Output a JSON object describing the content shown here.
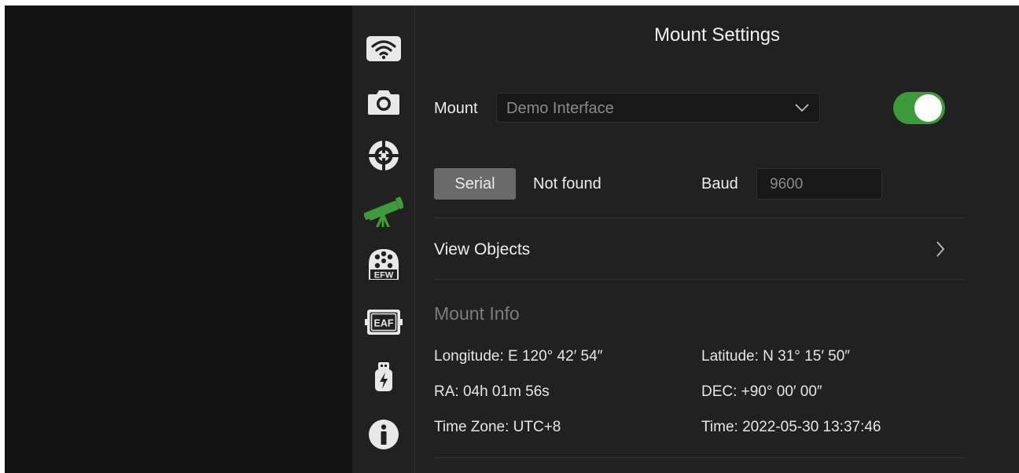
{
  "header": {
    "title": "Mount Settings"
  },
  "sidebar": {
    "items": [
      {
        "name": "wifi",
        "icon": "wifi-icon"
      },
      {
        "name": "camera",
        "icon": "camera-icon"
      },
      {
        "name": "guide",
        "icon": "crosshair-icon"
      },
      {
        "name": "mount",
        "icon": "telescope-icon",
        "active": true
      },
      {
        "name": "efw",
        "icon": "filter-wheel-icon",
        "label": "EFW"
      },
      {
        "name": "eaf",
        "icon": "focuser-icon",
        "label": "EAF"
      },
      {
        "name": "usb",
        "icon": "usb-power-icon"
      },
      {
        "name": "info",
        "icon": "info-icon"
      }
    ],
    "active_color": "#3f9a3a"
  },
  "mount": {
    "label": "Mount",
    "selected": "Demo Interface",
    "enabled": true
  },
  "connection": {
    "serial_label": "Serial",
    "status": "Not found",
    "baud_label": "Baud",
    "baud_placeholder": "9600"
  },
  "view_objects": {
    "label": "View Objects"
  },
  "mount_info": {
    "title": "Mount Info",
    "longitude": "Longitude: E 120° 42′ 54″",
    "latitude": "Latitude: N 31° 15′ 50″",
    "ra": "RA: 04h 01m 56s",
    "dec": "DEC: +90° 00′ 00″",
    "timezone": "Time Zone: UTC+8",
    "time": "Time: 2022-05-30 13:37:46"
  },
  "colors": {
    "accent": "#3d9a3a",
    "background": "#212121",
    "preview": "#121212"
  }
}
